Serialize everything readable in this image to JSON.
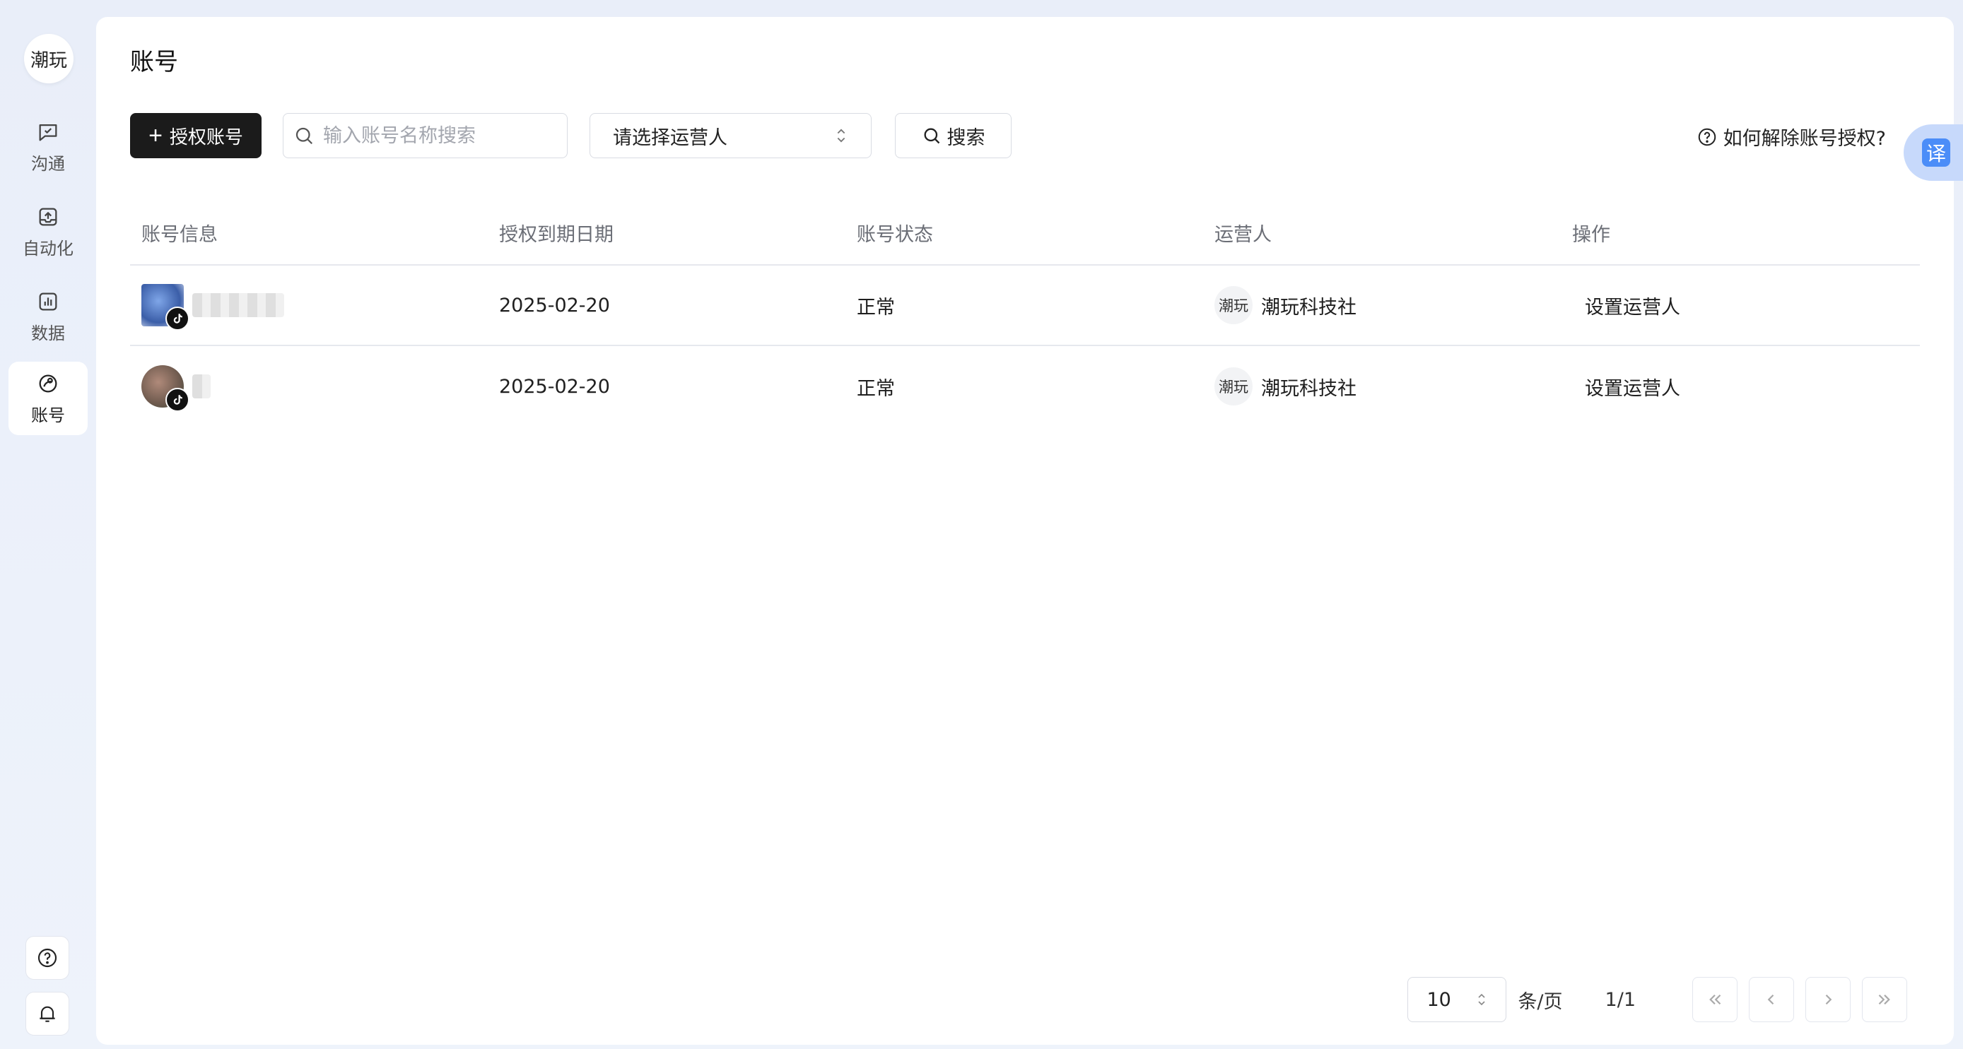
{
  "sidebar": {
    "logo_text": "潮玩",
    "items": [
      {
        "label": "沟通",
        "icon": "chat-icon"
      },
      {
        "label": "自动化",
        "icon": "automation-icon"
      },
      {
        "label": "数据",
        "icon": "chart-icon"
      },
      {
        "label": "账号",
        "icon": "account-icon",
        "active": true
      }
    ],
    "bottom": [
      {
        "icon": "help-icon"
      },
      {
        "icon": "bell-icon"
      }
    ]
  },
  "page": {
    "title": "账号"
  },
  "toolbar": {
    "authorize_label": "授权账号",
    "search_placeholder": "输入账号名称搜索",
    "operator_select": "请选择运营人",
    "search_label": "搜索",
    "help_link": "如何解除账号授权?"
  },
  "table": {
    "headers": [
      "账号信息",
      "授权到期日期",
      "账号状态",
      "运营人",
      "操作"
    ],
    "rows": [
      {
        "name": "",
        "expiry": "2025-02-20",
        "status": "正常",
        "operator_avatar": "潮玩",
        "operator": "潮玩科技社",
        "action": "设置运营人"
      },
      {
        "name": "",
        "expiry": "2025-02-20",
        "status": "正常",
        "operator_avatar": "潮玩",
        "operator": "潮玩科技社",
        "action": "设置运营人"
      }
    ]
  },
  "pagination": {
    "page_size": "10",
    "per_page_label": "条/页",
    "page_indicator": "1/1"
  },
  "translate_fab": "译",
  "colors": {
    "primary_button": "#1b1b1b",
    "background": "#eef2fa",
    "translate_accent": "#4b8df8"
  }
}
